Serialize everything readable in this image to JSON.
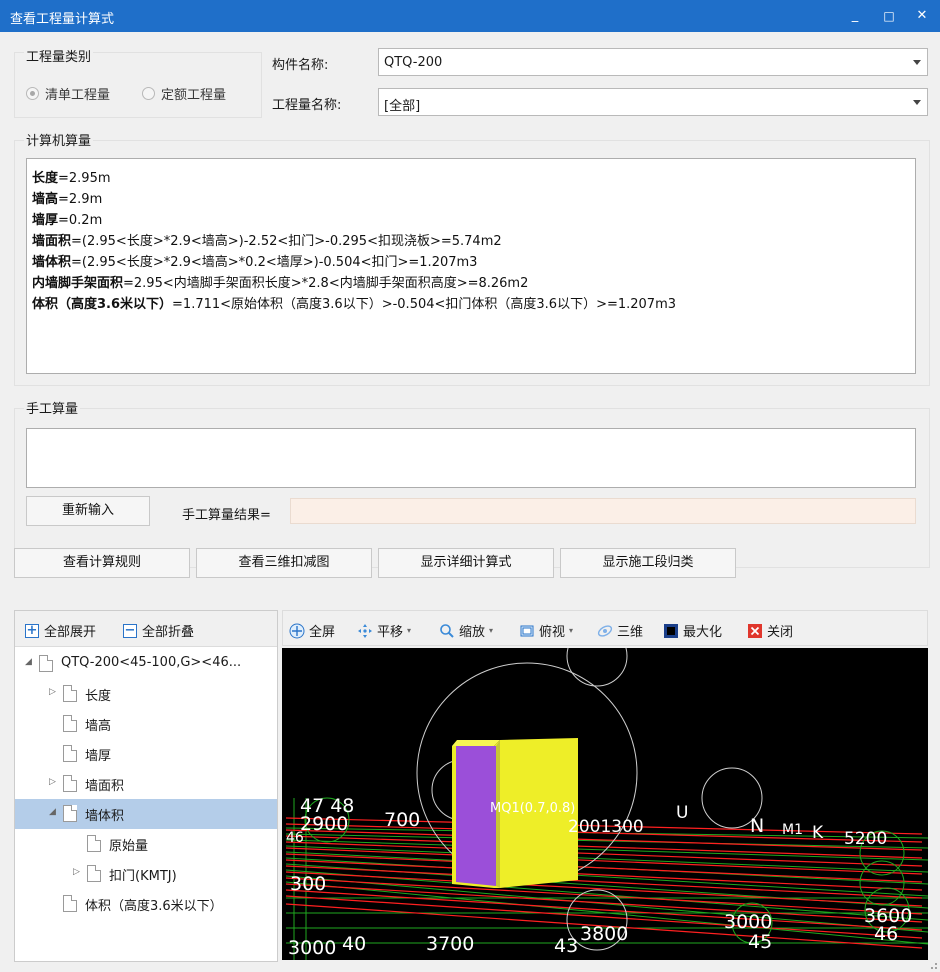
{
  "window": {
    "title": "查看工程量计算式",
    "minimize_glyph": "_",
    "maximize_glyph": "□",
    "close_glyph": "✕"
  },
  "quantity_type": {
    "group_label": "工程量类别",
    "options": [
      "清单工程量",
      "定额工程量"
    ],
    "selected_index": 0
  },
  "component": {
    "label": "构件名称:",
    "value": "QTQ-200"
  },
  "quantity_name": {
    "label": "工程量名称:",
    "value": "[全部]"
  },
  "computer_calc": {
    "group_label": "计算机算量",
    "lines": [
      {
        "bold": "长度",
        "rest": "=2.95m"
      },
      {
        "bold": "墙高",
        "rest": "=2.9m"
      },
      {
        "bold": "墙厚",
        "rest": "=0.2m"
      },
      {
        "bold": "墙面积",
        "rest": "=(2.95<长度>*2.9<墙高>)-2.52<扣门>-0.295<扣现浇板>=5.74m2"
      },
      {
        "bold": "墙体积",
        "rest": "=(2.95<长度>*2.9<墙高>*0.2<墙厚>)-0.504<扣门>=1.207m3"
      },
      {
        "bold": "内墙脚手架面积",
        "rest": "=2.95<内墙脚手架面积长度>*2.8<内墙脚手架面积高度>=8.26m2"
      },
      {
        "bold": "体积（高度3.6米以下）",
        "rest": "=1.711<原始体积（高度3.6以下）>-0.504<扣门体积（高度3.6以下）>=1.207m3"
      }
    ]
  },
  "manual_calc": {
    "group_label": "手工算量",
    "reenter_button": "重新输入",
    "result_label": "手工算量结果=",
    "result_value": ""
  },
  "actions": {
    "view_rules": "查看计算规则",
    "view_3d_deduction": "查看三维扣减图",
    "show_detailed": "显示详细计算式",
    "show_section": "显示施工段归类"
  },
  "tree_toolbar": {
    "expand_all": "全部展开",
    "collapse_all": "全部折叠"
  },
  "tree": [
    {
      "label": "QTQ-200<45-100,G><46...",
      "level": 0,
      "toggle": "◢",
      "selected": false
    },
    {
      "label": "长度",
      "level": 1,
      "toggle": "▷",
      "selected": false
    },
    {
      "label": "墙高",
      "level": 1,
      "toggle": "",
      "selected": false
    },
    {
      "label": "墙厚",
      "level": 1,
      "toggle": "",
      "selected": false
    },
    {
      "label": "墙面积",
      "level": 1,
      "toggle": "▷",
      "selected": false
    },
    {
      "label": "墙体积",
      "level": 1,
      "toggle": "◢",
      "selected": true
    },
    {
      "label": "原始量",
      "level": 2,
      "toggle": "",
      "selected": false
    },
    {
      "label": "扣门(KMTJ)",
      "level": 2,
      "toggle": "▷",
      "selected": false
    },
    {
      "label": "体积（高度3.6米以下）",
      "level": 1,
      "toggle": "",
      "selected": false
    }
  ],
  "view_toolbar": {
    "fullscreen": "全屏",
    "pan": "平移",
    "zoom": "缩放",
    "top_view": "俯视",
    "three_d": "三维",
    "maximize": "最大化",
    "close": "关闭"
  },
  "canvas_labels": {
    "a": "47 48",
    "b": "2900",
    "c": "700",
    "d": "46",
    "e": "300",
    "f": "3000",
    "g": "40",
    "h": "3700",
    "i": "43",
    "j": "3800",
    "k": "3000",
    "l": "45",
    "m": "3600",
    "n": "46",
    "o": "N",
    "p": "M1",
    "q": "K",
    "r": "MQ1(0.7,0.8)",
    "s": "2001300",
    "t": "U",
    "u": "5200"
  },
  "colors": {
    "titlebar": "#1f6fc9",
    "selection": "#b4cde9",
    "wall_yellow": "#f0f028",
    "wall_purple": "#9a4fd8",
    "grid_red": "#ff2020",
    "grid_green": "#20b020"
  }
}
